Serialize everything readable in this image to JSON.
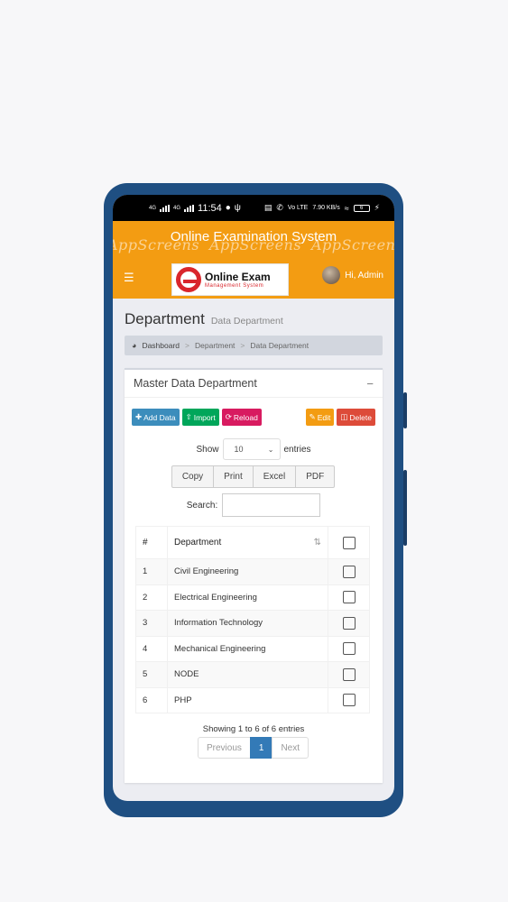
{
  "statusbar": {
    "time": "11:54",
    "net1": "4G",
    "net2": "4G",
    "volte": "Vo LTE",
    "speed": "7.90 KB/s",
    "battery": "6"
  },
  "header": {
    "app_title": "Online Examination System",
    "logo_title": "Online Exam",
    "logo_subtitle": "Management System",
    "user_greeting": "Hi, Admin"
  },
  "watermark": "AppScreens",
  "page": {
    "title": "Department",
    "subtitle": "Data Department",
    "breadcrumb": [
      "Dashboard",
      "Department",
      "Data Department"
    ]
  },
  "box": {
    "title": "Master Data Department",
    "collapse_symbol": "−"
  },
  "toolbar": {
    "add": "Add Data",
    "import": "Import",
    "reload": "Reload",
    "edit": "Edit",
    "delete": "Delete"
  },
  "length": {
    "label_show": "Show",
    "value": "10",
    "label_entries": "entries"
  },
  "export": [
    "Copy",
    "Print",
    "Excel",
    "PDF"
  ],
  "search": {
    "label": "Search:",
    "value": ""
  },
  "table": {
    "headers": [
      "#",
      "Department"
    ],
    "rows": [
      {
        "num": "1",
        "name": "Civil Engineering"
      },
      {
        "num": "2",
        "name": "Electrical Engineering"
      },
      {
        "num": "3",
        "name": "Information Technology"
      },
      {
        "num": "4",
        "name": "Mechanical Engineering"
      },
      {
        "num": "5",
        "name": "NODE"
      },
      {
        "num": "6",
        "name": "PHP"
      }
    ]
  },
  "info": "Showing 1 to 6 of 6 entries",
  "pagination": {
    "previous": "Previous",
    "current": "1",
    "next": "Next"
  },
  "colors": {
    "header": "#f39c12",
    "primary": "#3c8dbc",
    "success": "#00a65a",
    "maroon": "#d81b60",
    "warning": "#f39c12",
    "danger": "#dd4b39",
    "frame": "#1f4f82"
  }
}
